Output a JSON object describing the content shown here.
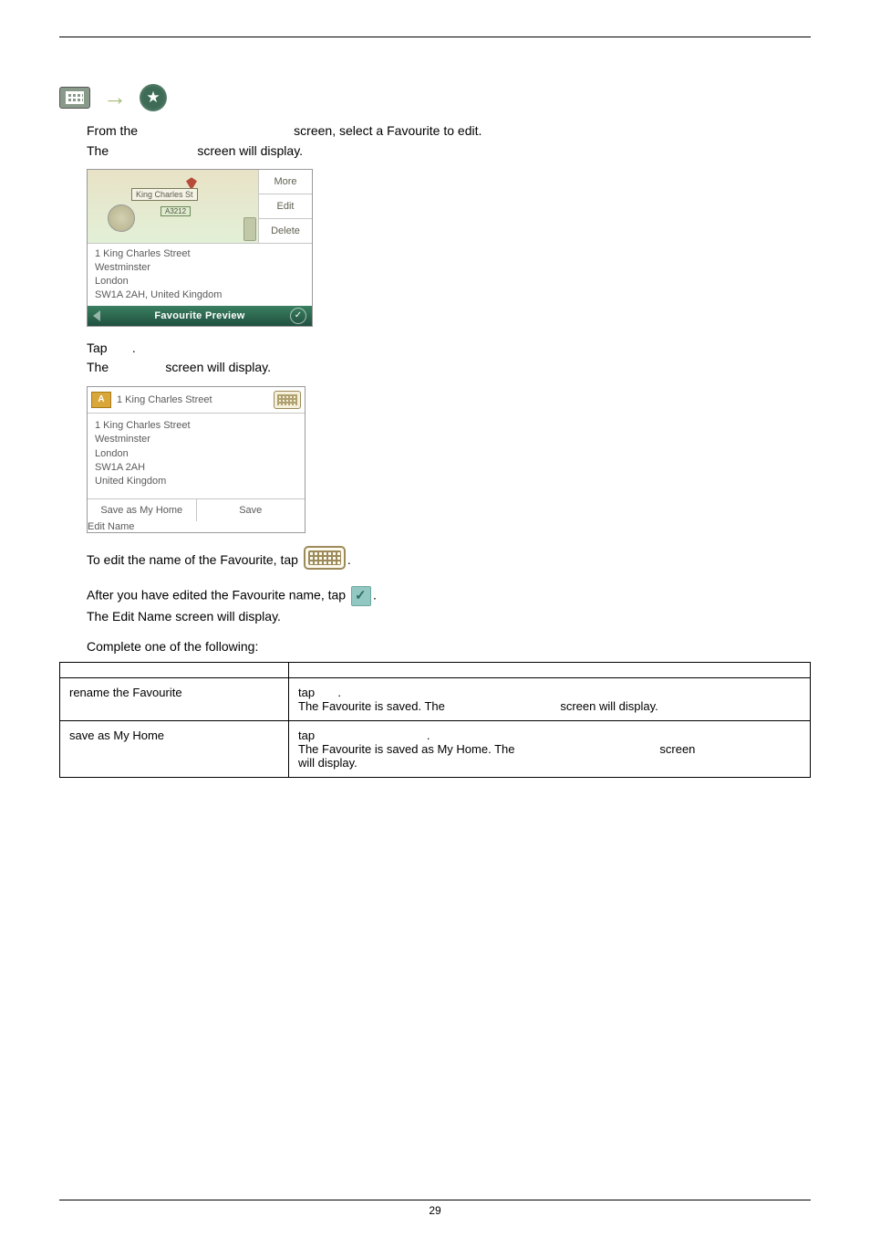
{
  "step1": {
    "line1_a": "From the",
    "line1_b": "screen, select a Favourite to edit.",
    "line2_a": "The",
    "line2_b": "screen will display."
  },
  "mock1": {
    "map_label": "King Charles St",
    "route_code": "A3212",
    "btn_more": "More",
    "btn_edit": "Edit",
    "btn_delete": "Delete",
    "addr_l1": "1 King Charles Street",
    "addr_l2": "Westminster",
    "addr_l3": "London",
    "addr_l4": "SW1A 2AH, United Kingdom",
    "footer_title": "Favourite Preview"
  },
  "step2": {
    "line1_a": "Tap",
    "line1_b": ".",
    "line2_a": "The",
    "line2_b": "screen will display."
  },
  "mock2": {
    "title": "1 King Charles Street",
    "addr_l1": "1 King Charles Street",
    "addr_l2": "Westminster",
    "addr_l3": "London",
    "addr_l4": "SW1A 2AH",
    "addr_l5": "United Kingdom",
    "btn_save_home": "Save as My Home",
    "btn_save": "Save",
    "footer_title": "Edit Name"
  },
  "step3": {
    "text_a": "To edit the name of the Favourite, tap",
    "text_b": "."
  },
  "step4": {
    "text_a": "After you have edited the Favourite name, tap",
    "text_b": ".",
    "text_c": "The Edit Name screen will display."
  },
  "step5": {
    "text": "Complete one of the following:"
  },
  "table": {
    "h1": "",
    "h2": "",
    "r1c1": "rename the Favourite",
    "r1c2_a": "tap",
    "r1c2_b": ".",
    "r1c2_c": "The Favourite is saved. The",
    "r1c2_d": "screen will display.",
    "r2c1": "save as My Home",
    "r2c2_a": "tap",
    "r2c2_b": ".",
    "r2c2_c": "The Favourite is saved as My Home. The",
    "r2c2_d": "screen",
    "r2c2_e": "will display."
  },
  "page_number": "29"
}
